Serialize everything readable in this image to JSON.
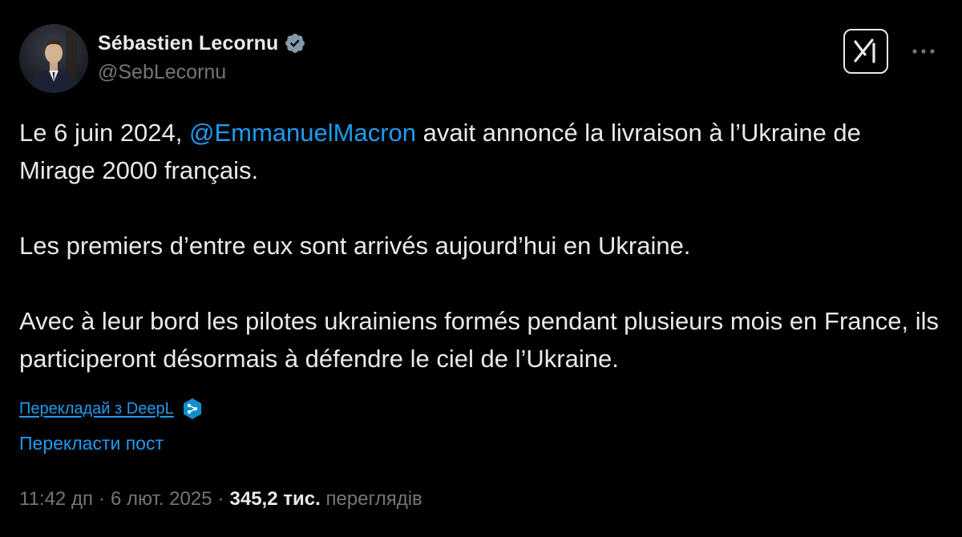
{
  "author": {
    "display_name": "Sébastien Lecornu",
    "handle": "@SebLecornu",
    "verified_badge_color": "#829aab"
  },
  "toolbar": {
    "grok_icon": "grok-icon",
    "more_icon": "more-dots-icon"
  },
  "tweet": {
    "p1_before": "Le 6 juin 2024, ",
    "mention": "@EmmanuelMacron",
    "p1_after": " avait annoncé la livraison à l’Ukraine de Mirage 2000 français.",
    "p2": "Les premiers d’entre eux sont arrivés aujourd’hui en Ukraine.",
    "p3": "Avec à leur bord les pilotes ukrainiens formés pendant plusieurs mois en France, ils participeront désormais à défendre le ciel de l’Ukraine."
  },
  "translation": {
    "deepl_label": "Перекладай з DeepL",
    "translate_post_label": "Перекласти пост"
  },
  "meta": {
    "time": "11:42 дп",
    "separator": "·",
    "date": "6 лют. 2025",
    "views_count": "345,2 тис.",
    "views_label": "переглядів"
  },
  "colors": {
    "background": "#000000",
    "text": "#e7e9ea",
    "secondary": "#71767b",
    "link": "#1d9bf0"
  }
}
